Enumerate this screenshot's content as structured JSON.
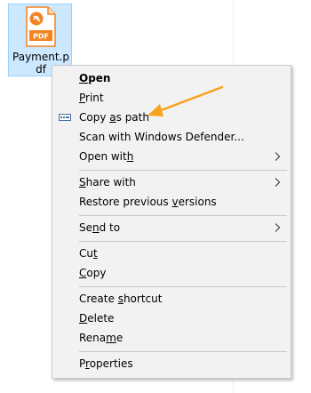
{
  "file": {
    "name": "Payment.pdf",
    "name_line1": "Payment.p",
    "name_line2": "df",
    "icon_text": "PDF"
  },
  "menu": {
    "open": {
      "pre": "",
      "key": "O",
      "post": "pen"
    },
    "print": {
      "pre": "",
      "key": "P",
      "post": "rint"
    },
    "copy_as_path": {
      "pre": "Copy ",
      "key": "a",
      "post": "s path"
    },
    "scan": {
      "pre": "Scan with Windows Defender...",
      "key": "",
      "post": ""
    },
    "open_with": {
      "pre": "Open wit",
      "key": "h",
      "post": ""
    },
    "share_with": {
      "pre": "",
      "key": "S",
      "post": "hare with"
    },
    "restore": {
      "pre": "Restore previous ",
      "key": "v",
      "post": "ersions"
    },
    "send_to": {
      "pre": "Se",
      "key": "n",
      "post": "d to"
    },
    "cut": {
      "pre": "Cu",
      "key": "t",
      "post": ""
    },
    "copy": {
      "pre": "",
      "key": "C",
      "post": "opy"
    },
    "create_shortcut": {
      "pre": "Create ",
      "key": "s",
      "post": "hortcut"
    },
    "delete": {
      "pre": "",
      "key": "D",
      "post": "elete"
    },
    "rename": {
      "pre": "Rena",
      "key": "m",
      "post": "e"
    },
    "properties": {
      "pre": "P",
      "key": "r",
      "post": "operties"
    }
  },
  "colors": {
    "selection": "#cce8ff",
    "menu_bg": "#f2f2f2",
    "arrow": "#f7a21b",
    "pdf_orange": "#f5821f"
  }
}
